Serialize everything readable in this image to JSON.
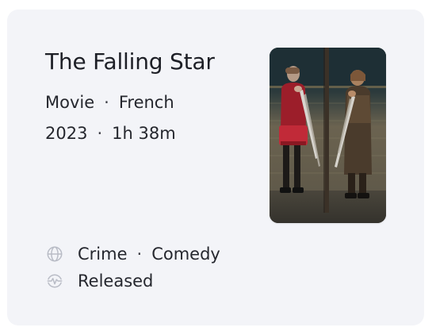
{
  "card": {
    "title": "The Falling Star",
    "type": "Movie",
    "language": "French",
    "year": "2023",
    "runtime": "1h 38m",
    "separator": "·",
    "genres": [
      "Crime",
      "Comedy"
    ],
    "status": "Released"
  },
  "icons": {
    "genre": "globe-icon",
    "status": "pulse-icon"
  },
  "colors": {
    "card_background": "#f3f4f8",
    "text": "#1d1f26",
    "icon": "#b9bcc6"
  }
}
